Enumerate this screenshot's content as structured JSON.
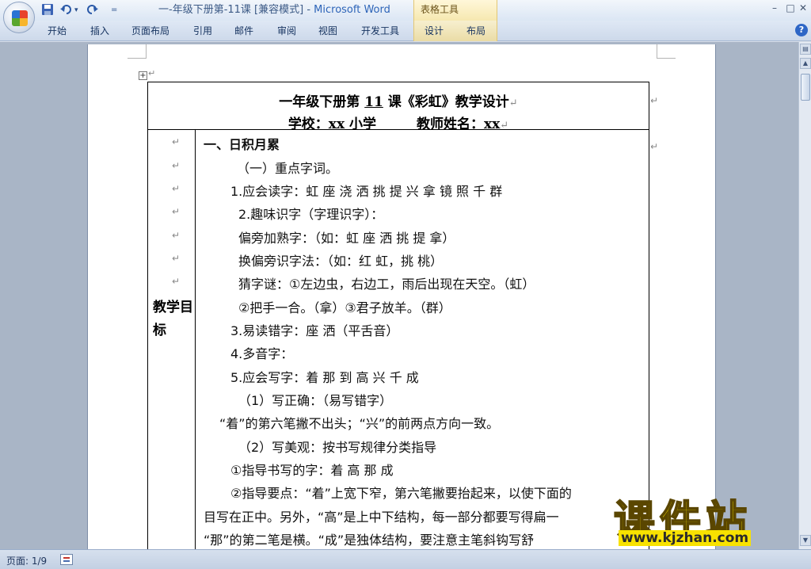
{
  "window": {
    "title_doc": "一-年级下册第-11课 [兼容模式] - ",
    "title_app": "Microsoft Word",
    "context_group": "表格工具",
    "controls": [
      "–",
      "□"
    ]
  },
  "quick_access": {
    "save_icon": "save-icon",
    "undo_icon": "undo-icon",
    "redo_icon": "redo-icon",
    "customize": "="
  },
  "ribbon": {
    "tabs": [
      "开始",
      "插入",
      "页面布局",
      "引用",
      "邮件",
      "审阅",
      "视图",
      "开发工具",
      "设计",
      "布局"
    ],
    "help": "?"
  },
  "document": {
    "title_pre": "一年级下册第 ",
    "title_num": "11",
    "title_post": " 课《彩虹》教学设计",
    "subtitle": "学校：xx 小学　　　教师姓名：xx",
    "goal_label": "教学目标",
    "lines": [
      "一、日积月累",
      "（一）重点字词。",
      "1.应会读字：虹 座 浇 洒 挑 提 兴 拿 镜 照 千 群",
      "2.趣味识字（字理识字）：",
      "偏旁加熟字：（如：虹 座 洒 挑 提 拿）",
      "换偏旁识字法：（如：红 虹，挑 桃）",
      "猜字谜：①左边虫，右边工，雨后出现在天空。（虹）",
      "②把手一合。（拿）③君子放羊。（群）",
      "3.易读错字：座 洒（平舌音）",
      "4.多音字：",
      "5.应会写字：着 那 到 高 兴 千 成",
      "（1）写正确：（易写错字）",
      "“着”的第六笔撇不出头；“兴”的前两点方向一致。",
      "（2）写美观：按书写规律分类指导",
      "①指导书写的字：着 高 那 成",
      "②指导要点：“着”上宽下窄，第六笔撇要抬起来，以使下面的",
      "目写在正中。另外，“高”是上中下结构，每一部分都要写得扁一",
      "“那”的第二笔是横。“成”是独体结构，要注意主笔斜钩写舒"
    ]
  },
  "watermark": {
    "brand": "课件站",
    "url": "www.kjzhan.com"
  },
  "status": {
    "page": "页面: 1/9"
  }
}
